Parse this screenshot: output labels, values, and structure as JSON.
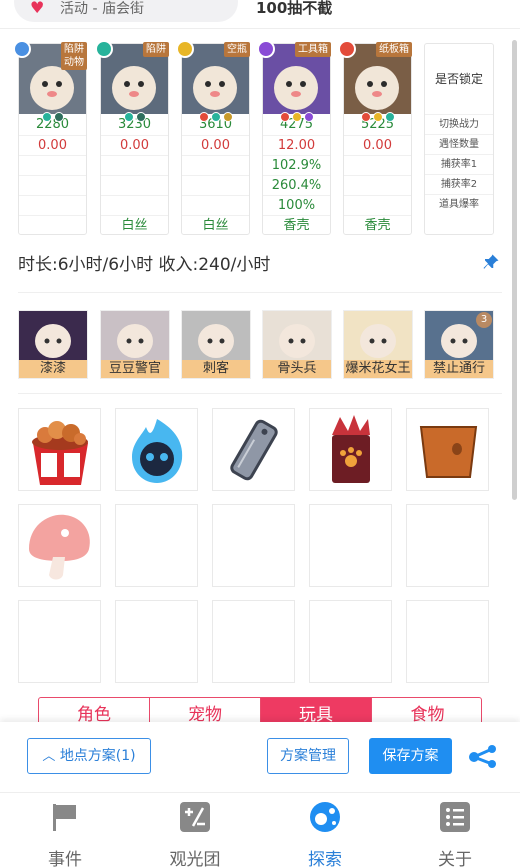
{
  "topbar": {
    "activity_text": "活动 - 庙会街",
    "right_text": "100抽不截"
  },
  "team": [
    {
      "tag": "陷阱\n动物",
      "tag1": "陷阱",
      "tag2": "动物",
      "elem_color": "#4a90e2",
      "bg": "#6d7886",
      "power": "2280",
      "count": "0.00",
      "r1": "",
      "r2": "",
      "r3": "",
      "item": ""
    },
    {
      "tag1": "陷阱",
      "tag2": "",
      "elem_color": "#27b39b",
      "bg": "#5d6b7c",
      "power": "3230",
      "count": "0.00",
      "r1": "",
      "r2": "",
      "r3": "",
      "item": "白丝"
    },
    {
      "tag1": "空瓶",
      "tag2": "",
      "elem_color": "#e8b627",
      "bg": "#5f6d80",
      "power": "3610",
      "count": "0.00",
      "r1": "",
      "r2": "",
      "r3": "",
      "item": "白丝"
    },
    {
      "tag1": "工具箱",
      "tag2": "",
      "elem_color": "#8a4bd6",
      "bg": "#6a4fa4",
      "power": "4275",
      "count": "12.00",
      "r1": "102.9%",
      "r2": "260.4%",
      "r3": "100%",
      "item": "香壳"
    },
    {
      "tag1": "纸板箱",
      "tag2": "",
      "elem_color": "#e34b3a",
      "bg": "#7a5e46",
      "power": "5225",
      "count": "0.00",
      "r1": "",
      "r2": "",
      "r3": "",
      "item": "香壳"
    }
  ],
  "labels": {
    "lock": "是否锁定",
    "rows": [
      "切换战力",
      "遇怪数量",
      "捕获率1",
      "捕获率2",
      "道具爆率"
    ]
  },
  "summary": "时长:6小时/6小时 收入:240/小时",
  "characters": [
    {
      "name": "漆漆",
      "count": ""
    },
    {
      "name": "豆豆警官",
      "count": ""
    },
    {
      "name": "刺客",
      "count": ""
    },
    {
      "name": "骨头兵",
      "count": ""
    },
    {
      "name": "爆米花女王",
      "count": ""
    },
    {
      "name": "禁止通行",
      "count": "3"
    }
  ],
  "tabs": [
    {
      "label": "角色",
      "active": false
    },
    {
      "label": "宠物",
      "active": false
    },
    {
      "label": "玩具",
      "active": true
    },
    {
      "label": "食物",
      "active": false
    }
  ],
  "actions": {
    "location_plan": "地点方案(1)",
    "plan_manage": "方案管理",
    "save_plan": "保存方案"
  },
  "nav": [
    {
      "label": "事件",
      "icon": "flag-icon",
      "active": false
    },
    {
      "label": "观光团",
      "icon": "calculator-icon",
      "active": false
    },
    {
      "label": "探索",
      "icon": "explore-icon",
      "active": true
    },
    {
      "label": "关于",
      "icon": "list-icon",
      "active": false
    }
  ],
  "colors": {
    "accent_blue": "#1f8ef1",
    "accent_pink": "#e8335a",
    "gold": "#f5c78a"
  }
}
